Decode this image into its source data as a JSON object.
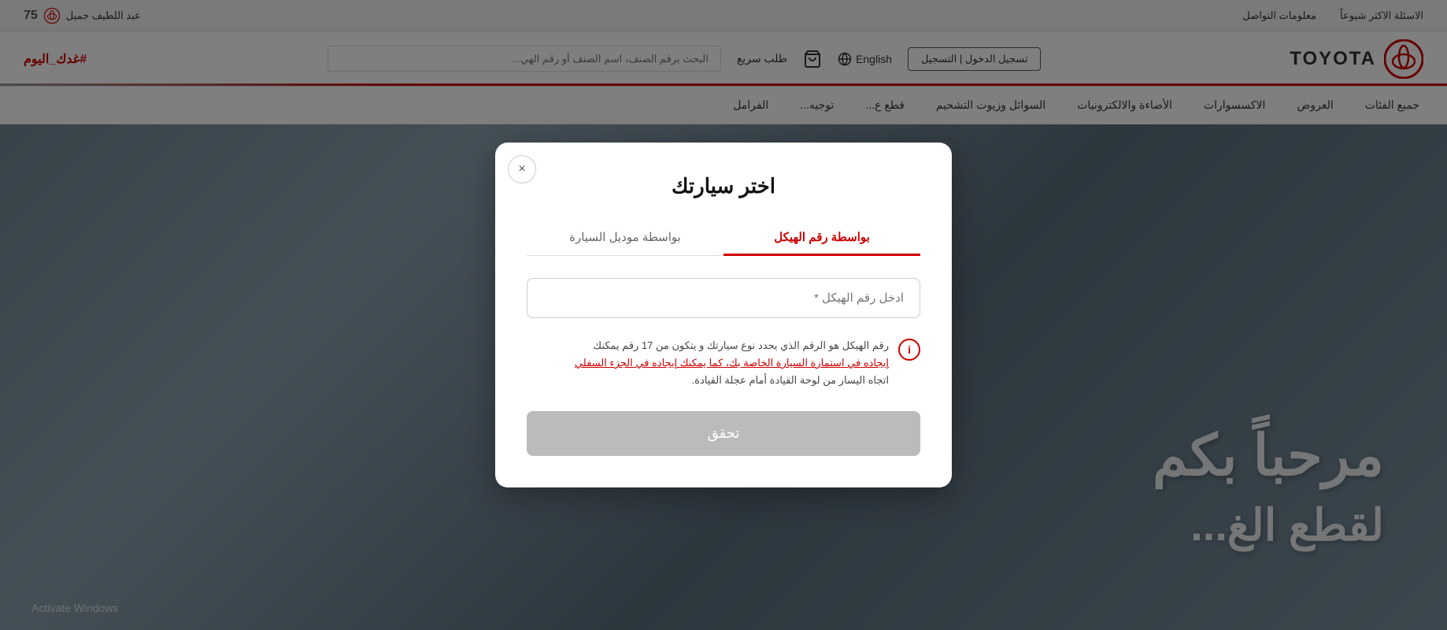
{
  "topbar": {
    "faq_label": "الاسئلة الاكثر شيوعاً",
    "contact_label": "معلومات التواصل",
    "brand_label": "عبد اللطيف جميل",
    "anniversary": "75"
  },
  "nav": {
    "logo_text": "TOYOTA",
    "hashtag": "#غدك_اليوم",
    "login_label": "تسجيل الدخول",
    "register_label": "التسجيل",
    "lang_label": "English",
    "quick_order_label": "طلب سريع",
    "search_placeholder": "البحث برقم الصنف، اسم الصنف أو رقم الهي..."
  },
  "secondary_nav": {
    "items": [
      {
        "label": "جميع الفئات"
      },
      {
        "label": "العروض"
      },
      {
        "label": "الاكسسوارات"
      },
      {
        "label": "الأضاءة والالكترونيات"
      },
      {
        "label": "السوائل وزيوت التشحيم"
      },
      {
        "label": "قطع ع..."
      },
      {
        "label": "توجيه..."
      },
      {
        "label": "الفرامل"
      }
    ]
  },
  "modal": {
    "title": "اختر سيارتك",
    "tab_vin": "بواسطة رقم الهيكل",
    "tab_model": "بواسطة موديل السيارة",
    "vin_placeholder": "ادخل رقم الهيكل *",
    "info_text_line1": "رقم الهيكل هو الرقم الذي يحدد نوع سيارتك و يتكون من 17 رقم يمكنك",
    "info_text_line2": "إيجاده في استمارة السيارة الخاصة بك، كما يمكنك إيجاده في الجزء السفلي",
    "info_text_line3": "اتجاه اليسار من لوحة القيادة أمام عجلة القيادة.",
    "submit_label": "تحقق",
    "close_label": "×"
  },
  "background": {
    "welcome_text": "مرحباً بكم",
    "parts_text": "لقطع الغ..."
  }
}
